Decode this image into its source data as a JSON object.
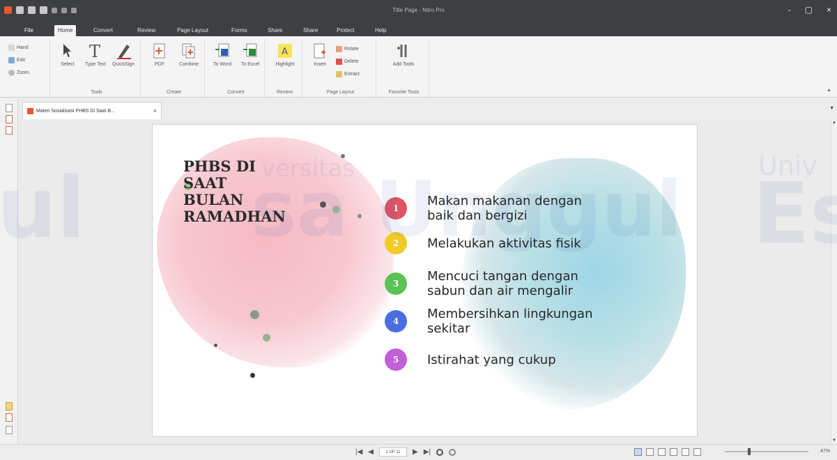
{
  "window": {
    "title": "Title Page - Nitro Pro",
    "controls": [
      "-",
      "▢",
      "×"
    ]
  },
  "menu": {
    "file": "File",
    "tabs": [
      "Home",
      "Convert",
      "Review",
      "Page Layout",
      "Forms",
      "Share",
      "Share",
      "Protect",
      "Help"
    ],
    "active": "Home"
  },
  "ribbon": {
    "nav": {
      "hand": "Hand",
      "edit": "Edit",
      "zoom": "Zoom"
    },
    "tools": {
      "select": "Select",
      "type_text": "Type Text",
      "quicksign": "QuickSign",
      "label": "Tools"
    },
    "create": {
      "pdf": "PDF",
      "combine": "Combine",
      "label": "Create"
    },
    "convert": {
      "to_word": "To Word",
      "to_excel": "To Excel",
      "label": "Convert"
    },
    "review": {
      "highlight": "Highlight",
      "label": "Review"
    },
    "page_layout": {
      "insert": "Insert",
      "rotate": "Rotate",
      "delete": "Delete",
      "extract": "Extract",
      "label": "Page Layout"
    },
    "favorite": {
      "add_tools": "Add Tools",
      "label": "Favorite Tools"
    }
  },
  "document_tab": {
    "title": "Materi Sosialisasi PHBS Di Saat B..."
  },
  "slide": {
    "title_lines": [
      "PHBS DI",
      "SAAT",
      "BULAN",
      "RAMADHAN"
    ],
    "items": [
      {
        "number": "1",
        "color": "#e05566",
        "lines": [
          "Makan makanan dengan",
          "baik dan bergizi"
        ]
      },
      {
        "number": "2",
        "color": "#f1cb2a",
        "lines": [
          "Melakukan aktivitas fisik"
        ]
      },
      {
        "number": "3",
        "color": "#5bc353",
        "lines": [
          "Mencuci tangan dengan",
          "sabun dan air mengalir"
        ]
      },
      {
        "number": "4",
        "color": "#4a6ee0",
        "lines": [
          "Membersihkan lingkungan",
          "sekitar"
        ]
      },
      {
        "number": "5",
        "color": "#c25ed8",
        "lines": [
          "Istirahat yang cukup"
        ]
      }
    ]
  },
  "watermark": {
    "big_left": "ul",
    "big_center": "sa Unggul",
    "small_center": "versitas",
    "big_right": "Es",
    "small_right": "Univ"
  },
  "statusbar": {
    "page_indicator": "1 OF 11",
    "zoom": "47%"
  }
}
